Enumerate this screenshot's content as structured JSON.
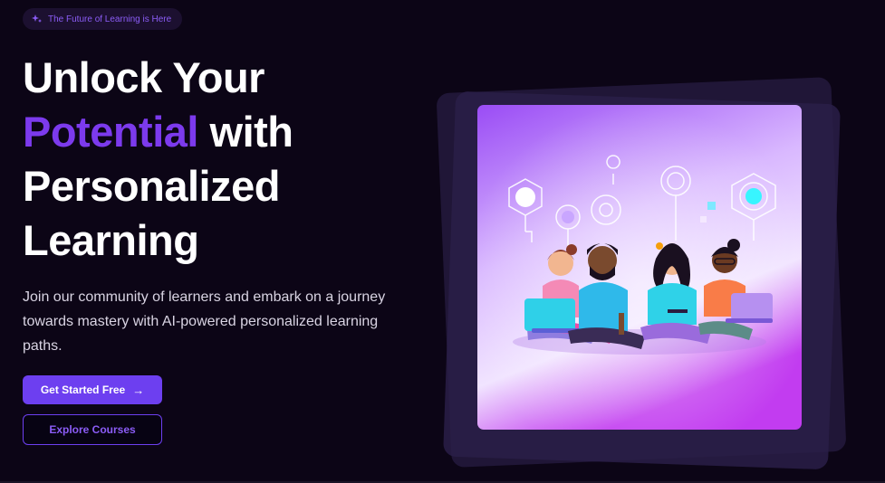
{
  "badge": {
    "icon": "sparkle-icon",
    "text": "The Future of Learning is Here"
  },
  "headline": {
    "line1": "Unlock Your",
    "accent": "Potential",
    "line2_rest": " with",
    "line3": "Personalized",
    "line4": "Learning"
  },
  "subheading": "Join our community of learners and embark on a journey towards mastery with AI-powered personalized learning paths.",
  "buttons": {
    "primary": {
      "label": "Get Started Free",
      "icon": "arrow-right-icon"
    },
    "secondary": {
      "label": "Explore Courses"
    }
  },
  "colors": {
    "background": "#0c0516",
    "accent": "#7c3aed",
    "primary_button": "#6d3ff0",
    "badge_bg": "#1c1030"
  },
  "hero_image": {
    "subject": "students-learning-illustration"
  }
}
